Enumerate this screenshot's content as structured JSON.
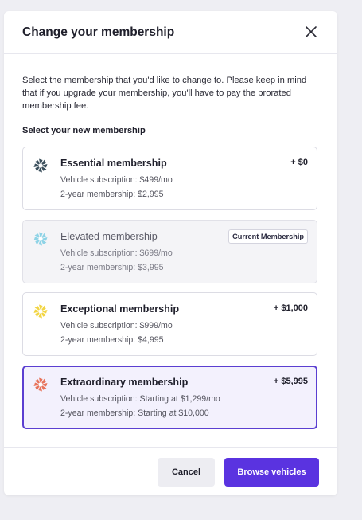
{
  "modal": {
    "title": "Change your membership",
    "intro": "Select the membership that you'd like to change to. Please keep in mind that if you upgrade your membership, you'll have to pay the prorated membership fee.",
    "section_label": "Select your new membership"
  },
  "memberships": [
    {
      "name": "Essential membership",
      "vehicle": "Vehicle subscription:  $499/mo",
      "two_year": "2-year membership: $2,995",
      "price": "+ $0",
      "icon": "star-burst-icon",
      "icon_color": "#3b4f5c",
      "state": "default"
    },
    {
      "name": "Elevated membership",
      "vehicle": "Vehicle subscription:  $699/mo",
      "two_year": "2-year membership: $3,995",
      "badge": "Current Membership",
      "icon": "star-burst-icon",
      "icon_color": "#8ed3e6",
      "state": "current"
    },
    {
      "name": "Exceptional membership",
      "vehicle": "Vehicle subscription:  $999/mo",
      "two_year": "2-year membership: $4,995",
      "price": "+ $1,000",
      "icon": "star-burst-icon",
      "icon_color": "#f2d544",
      "state": "default"
    },
    {
      "name": "Extraordinary membership",
      "vehicle": "Vehicle subscription: Starting at $1,299/mo",
      "two_year": "2-year membership: Starting at $10,000",
      "price": "+ $5,995",
      "icon": "star-burst-icon",
      "icon_color": "#e8735a",
      "state": "selected"
    }
  ],
  "footer": {
    "cancel_label": "Cancel",
    "primary_label": "Browse vehicles"
  },
  "colors": {
    "accent": "#5a33e0",
    "selected_border": "#5b3fd1",
    "selected_bg": "#f3f1fd"
  }
}
